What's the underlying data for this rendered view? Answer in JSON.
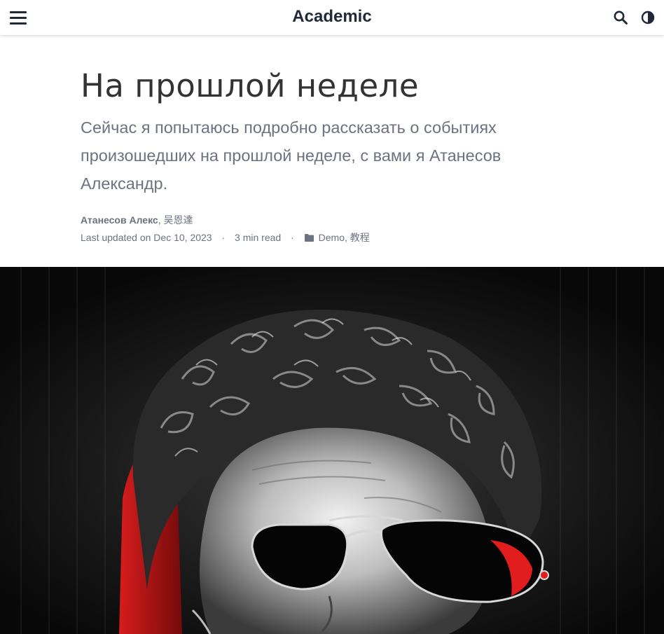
{
  "navbar": {
    "brand": "Academic",
    "menu_icon": "hamburger-menu-icon",
    "search_icon": "search-icon",
    "theme_icon": "moon-icon"
  },
  "article": {
    "title": "На прошлой неделе",
    "subtitle": "Сейчас я попытаюсь подробно рассказать о событиях произошедших на прошлой неделе, с вами я Атанесов Александр.",
    "authors": [
      "Атанесов Алекс",
      "吴恩達"
    ],
    "author_separator": ",",
    "last_updated": "Last updated on Dec 10, 2023",
    "reading_time": "3 min read",
    "separator": "·",
    "categories": [
      "Demo",
      "教程"
    ],
    "category_separator": ",",
    "category_icon": "folder-icon"
  },
  "featured_image": {
    "description": "featured-image",
    "accent_color": "#e11d1d"
  },
  "colors": {
    "text": "#333333",
    "muted": "#6b7280",
    "navbar_bg": "#ffffff"
  }
}
